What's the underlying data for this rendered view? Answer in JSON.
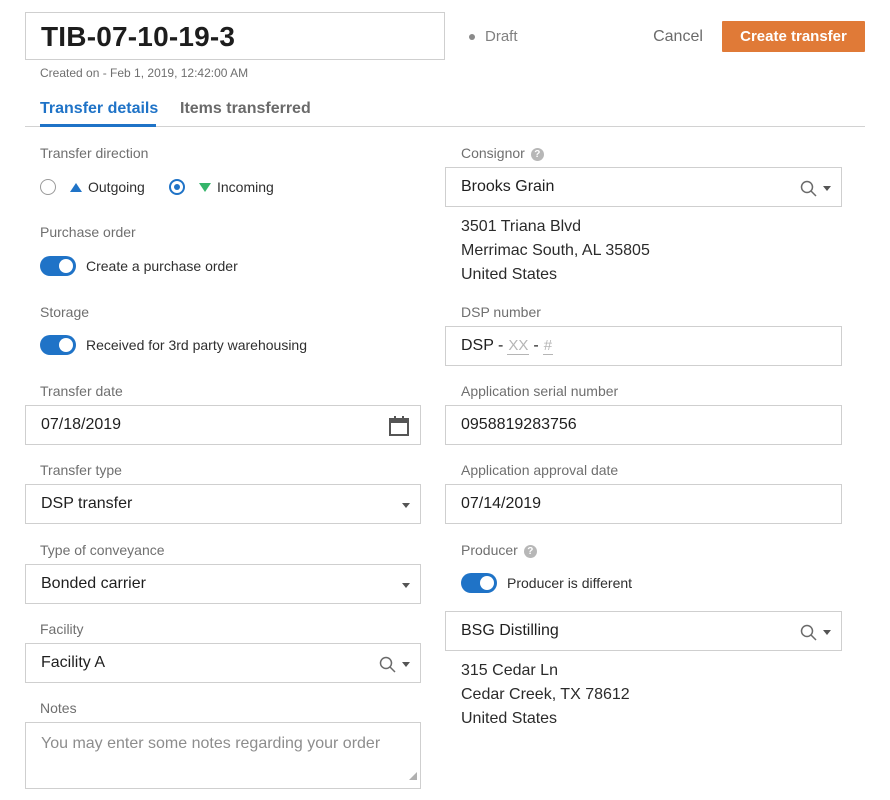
{
  "header": {
    "title": "TIB-07-10-19-3",
    "created": "Created on - Feb 1, 2019, 12:42:00 AM",
    "status": "Draft",
    "cancel_label": "Cancel",
    "create_label": "Create transfer"
  },
  "tabs": [
    {
      "label": "Transfer details",
      "active": true
    },
    {
      "label": "Items transferred",
      "active": false
    }
  ],
  "left": {
    "transfer_direction": {
      "label": "Transfer direction",
      "options": [
        {
          "label": "Outgoing",
          "selected": false,
          "icon": "arrow-up-icon"
        },
        {
          "label": "Incoming",
          "selected": true,
          "icon": "arrow-down-icon"
        }
      ]
    },
    "purchase_order": {
      "label": "Purchase order",
      "toggle_label": "Create a purchase order",
      "on": true
    },
    "storage": {
      "label": "Storage",
      "toggle_label": "Received for 3rd party warehousing",
      "on": true
    },
    "transfer_date": {
      "label": "Transfer date",
      "value": "07/18/2019"
    },
    "transfer_type": {
      "label": "Transfer type",
      "value": "DSP transfer"
    },
    "conveyance": {
      "label": "Type of conveyance",
      "value": "Bonded carrier"
    },
    "facility": {
      "label": "Facility",
      "value": "Facility A"
    },
    "notes": {
      "label": "Notes",
      "placeholder": "You may enter some notes regarding your order"
    }
  },
  "right": {
    "consignor": {
      "label": "Consignor",
      "value": "Brooks Grain",
      "address": [
        "3501 Triana Blvd",
        "Merrimac South, AL 35805",
        "United States"
      ]
    },
    "dsp_number": {
      "label": "DSP number",
      "prefix": "DSP -",
      "part1": "XX",
      "sep": "-",
      "part2": "#"
    },
    "serial_number": {
      "label": "Application serial number",
      "value": "0958819283756"
    },
    "approval_date": {
      "label": "Application approval date",
      "value": "07/14/2019"
    },
    "producer": {
      "label": "Producer",
      "toggle_label": "Producer is different",
      "on": true,
      "value": "BSG Distilling",
      "address": [
        "315 Cedar Ln",
        "Cedar Creek, TX 78612",
        "United States"
      ]
    }
  },
  "colors": {
    "accent": "#1f73c7",
    "primary_button": "#e07a37",
    "incoming_arrow": "#35b56a"
  }
}
